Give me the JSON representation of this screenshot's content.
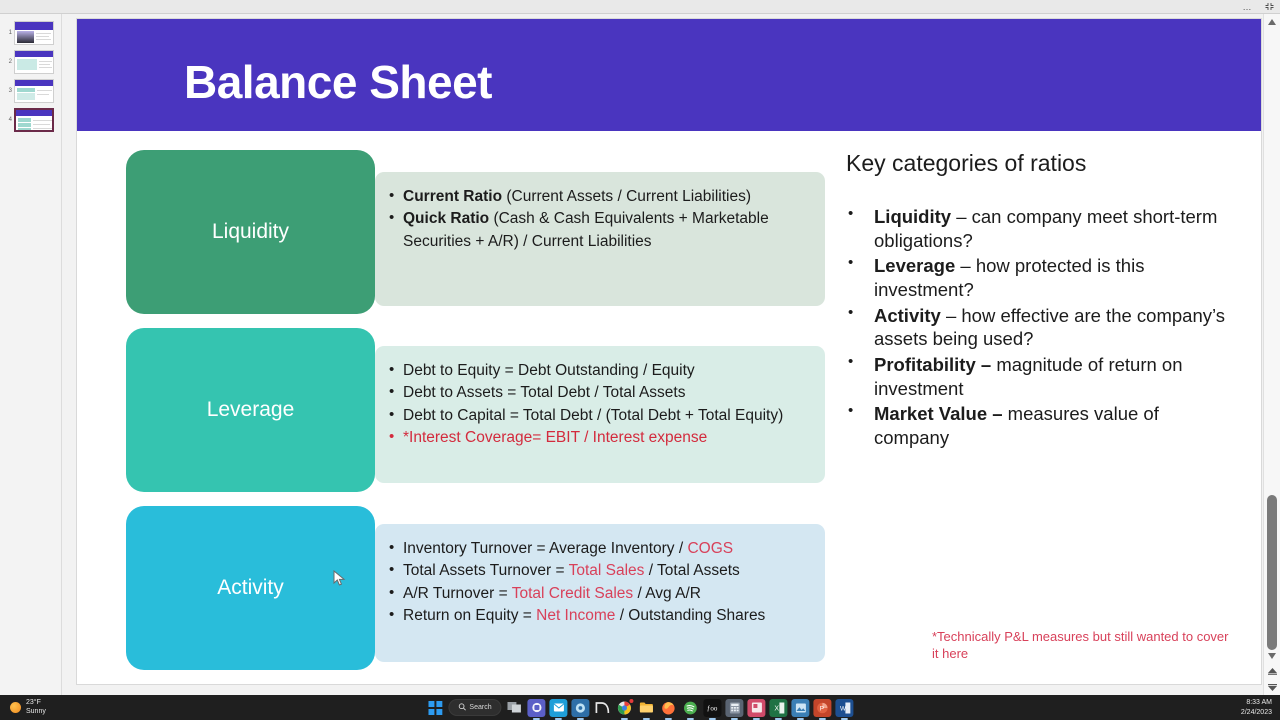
{
  "window": {
    "more_options": "…",
    "restore_icon": "restore-down-icon"
  },
  "thumbnails": {
    "items": [
      {
        "number": "1",
        "selected": false
      },
      {
        "number": "2",
        "selected": false
      },
      {
        "number": "3",
        "selected": false
      },
      {
        "number": "4",
        "selected": true
      }
    ]
  },
  "slide": {
    "title": "Balance Sheet",
    "header_color": "#4a35bf",
    "rows": [
      {
        "category": "Liquidity",
        "box_color": "#3d9e75",
        "panel_color": "#d9e5dc",
        "bullets": [
          {
            "bold": "Current Ratio",
            "rest": " (Current Assets / Current Liabilities)",
            "red": false
          },
          {
            "bold": "Quick Ratio",
            "rest": " (Cash & Cash Equivalents + Marketable Securities + A/R) / Current Liabilities",
            "red": false
          }
        ]
      },
      {
        "category": "Leverage",
        "box_color": "#35c4b0",
        "panel_color": "#d9ede7",
        "bullets": [
          {
            "bold": "",
            "rest": "Debt to Equity = Debt Outstanding / Equity",
            "red": false
          },
          {
            "bold": "",
            "rest": "Debt to Assets = Total Debt / Total Assets",
            "red": false
          },
          {
            "bold": "",
            "rest": "Debt to Capital = Total Debt / (Total Debt + Total Equity)",
            "red": false
          },
          {
            "bold": "",
            "rest": "*Interest Coverage= EBIT / Interest expense",
            "red": true
          }
        ]
      },
      {
        "category": "Activity",
        "box_color": "#29bdda",
        "panel_color": "#d4e7f2",
        "bullets": [
          {
            "pre": "Inventory Turnover = Average Inventory / ",
            "hi": "COGS",
            "post": ""
          },
          {
            "pre": "Total Assets Turnover = ",
            "hi": "Total Sales",
            "post": " / Total Assets"
          },
          {
            "pre": "A/R Turnover = ",
            "hi": "Total Credit Sales",
            "post": " / Avg A/R"
          },
          {
            "pre": "Return on Equity = ",
            "hi": "Net Income",
            "post": " / Outstanding Shares"
          }
        ]
      }
    ],
    "right_column": {
      "heading": "Key categories of ratios",
      "items": [
        {
          "bold": "Liquidity",
          "rest": " – can company meet short-term obligations?"
        },
        {
          "bold": "Leverage",
          "rest": " – how protected is this investment?"
        },
        {
          "bold": "Activity",
          "rest": " – how effective are the company’s assets being used?"
        },
        {
          "bold": "Profitability –",
          "rest": " magnitude of return on investment"
        },
        {
          "bold": "Market Value –",
          "rest": " measures value of company"
        }
      ]
    },
    "footnote": "*Technically P&L measures but still wanted to cover it here",
    "accent_red": "#d8415a"
  },
  "taskbar": {
    "weather_temp": "23°F",
    "weather_cond": "Sunny",
    "search_label": "Search",
    "clock_time": "8:33 AM",
    "clock_date": "2/24/2023",
    "icons": [
      "start-icon",
      "task-view-icon",
      "teams-icon",
      "mail-icon",
      "settings-icon",
      "nvidia-icon",
      "chrome-icon",
      "file-explorer-icon",
      "firefox-icon",
      "spotify-icon",
      "app-icon",
      "calculator-icon",
      "sticky-notes-icon",
      "excel-icon",
      "photos-icon",
      "powerpoint-icon",
      "word-icon"
    ]
  }
}
